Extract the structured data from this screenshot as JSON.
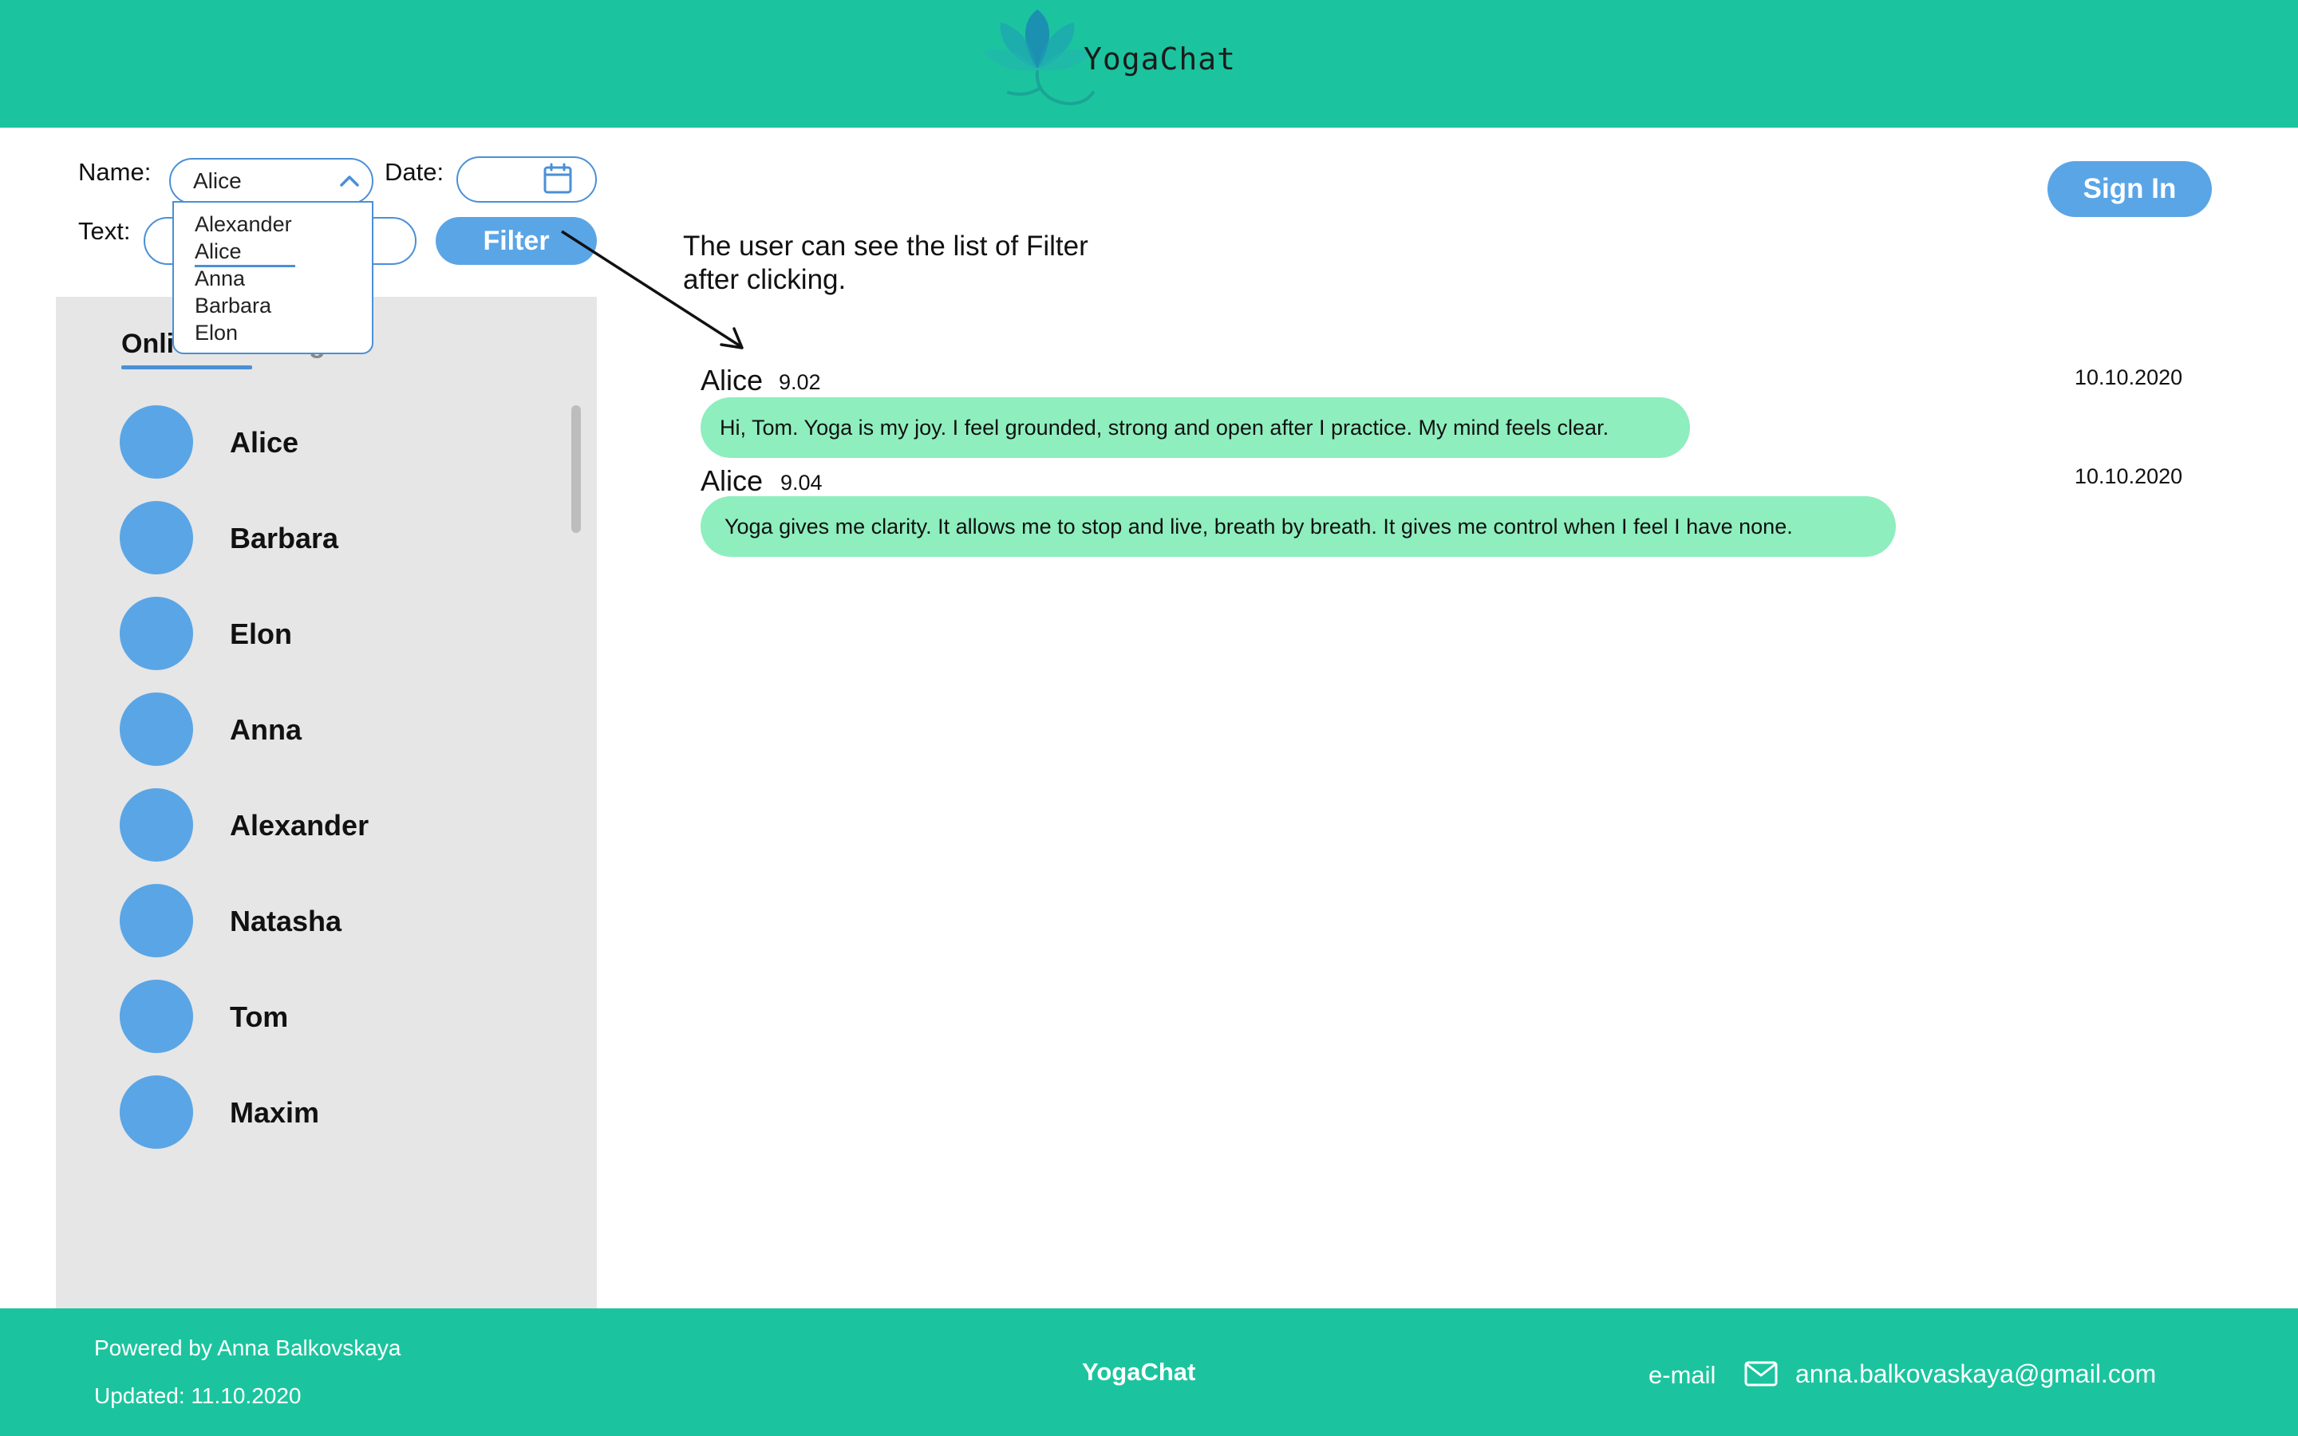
{
  "header": {
    "brand": "YogaChat"
  },
  "filters": {
    "name_label": "Name:",
    "name_value": "Alice",
    "date_label": "Date:",
    "text_label": "Text:",
    "filter_button": "Filter",
    "name_options": [
      "Alexander",
      "Alice",
      "Anna",
      "Barbara",
      "Elon"
    ]
  },
  "auth": {
    "sign_in": "Sign In"
  },
  "sidebar": {
    "tabs": {
      "online": "Onli",
      "dialogues": "alogues"
    },
    "contacts": [
      "Alice",
      "Barbara",
      "Elon",
      "Anna",
      "Alexander",
      "Natasha",
      "Tom",
      "Maxim"
    ]
  },
  "annotation": {
    "text": "The user can see the list of Filter after clicking."
  },
  "messages": [
    {
      "name": "Alice",
      "time": "9.02",
      "date": "10.10.2020",
      "text": "Hi, Tom. Yoga is my joy. I feel grounded, strong and open after I practice. My mind feels clear."
    },
    {
      "name": "Alice",
      "time": "9.04",
      "date": "10.10.2020",
      "text": "Yoga gives me clarity. It allows me to stop and live, breath by breath. It gives me control when I feel I have none."
    }
  ],
  "footer": {
    "powered_by": "Powered by Anna Balkovskaya",
    "updated": "Updated: 11.10.2020",
    "brand": "YogaChat",
    "email_label": "e-mail",
    "email": "anna.balkovaskaya@gmail.com"
  },
  "colors": {
    "primary": "#1bc49e",
    "accent": "#5aa5e6",
    "bubble": "#8eeebe",
    "sidebar_bg": "#e6e6e6"
  },
  "icons": [
    "lotus-logo-icon",
    "chevron-up-icon",
    "calendar-icon",
    "mail-icon"
  ]
}
